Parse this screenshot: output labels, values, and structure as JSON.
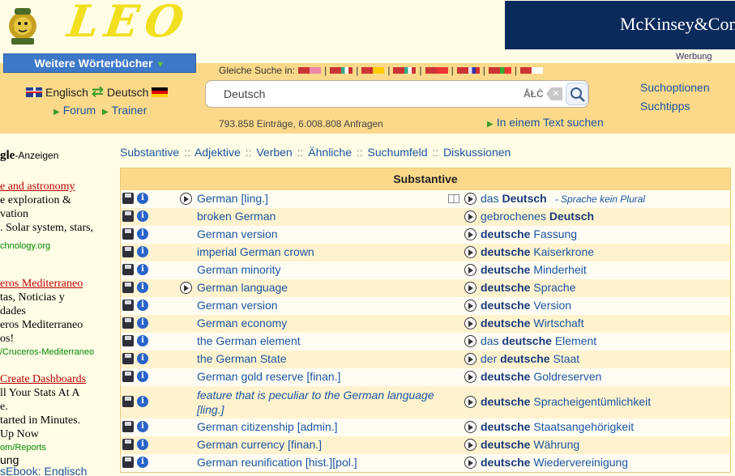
{
  "header": {
    "logo_text": "LEO",
    "ad_banner_text": "McKinsey&Company",
    "ad_label": "Werbung",
    "more_dicts_label": "Weitere Wörterbücher",
    "lang_from": "Englisch",
    "lang_to": "Deutsch",
    "forum_label": "Forum",
    "trainer_label": "Trainer",
    "same_search_label": "Gleiche Suche in:",
    "search_value": "Deutsch",
    "special_chars_label": "ÅŁĊ",
    "counts_text": "793.858 Einträge, 6.008.808 Anfragen",
    "text_search_label": "In einem Text suchen",
    "options": [
      "Suchoptionen",
      "Suchtipps"
    ]
  },
  "left_ads": {
    "google_label": "gle",
    "google_suffix": "-Anzeigen",
    "ads": [
      {
        "title": "e and astronomy",
        "lines": [
          "e exploration &",
          "vation",
          ". Solar system, stars,"
        ],
        "url": "chnology.org"
      },
      {
        "title": "eros Mediterraneo",
        "lines": [
          "tas, Noticias y",
          "dades",
          "eros Mediterraneo",
          "os!"
        ],
        "url": "/Cruceros-Mediterraneo"
      },
      {
        "title": "Create Dashboards",
        "lines": [
          "ll Your Stats At A",
          "e.",
          "tarted in Minutes.",
          "Up Now"
        ],
        "url": "om/Reports"
      }
    ],
    "tail": "ung",
    "ebook": "sEbook: Englisch"
  },
  "nav": {
    "items": [
      "Substantive",
      "Adjektive",
      "Verben",
      "Ähnliche",
      "Suchumfeld",
      "Diskussionen"
    ],
    "sep": "::"
  },
  "results": {
    "heading": "Substantive",
    "rows": [
      {
        "en": "German [ling.]",
        "de_pre": "das ",
        "de_bold": "Deutsch",
        "de_post": "",
        "gram": "- Sprache  kein Plural",
        "en_play": true,
        "book": true
      },
      {
        "en": "broken German",
        "de_pre": "gebrochenes ",
        "de_bold": "Deutsch",
        "de_post": ""
      },
      {
        "en": "German version",
        "de_pre": "",
        "de_bold": "deutsche",
        "de_post": " Fassung"
      },
      {
        "en": "imperial German crown",
        "de_pre": "",
        "de_bold": "deutsche",
        "de_post": " Kaiserkrone"
      },
      {
        "en": "German minority",
        "de_pre": "",
        "de_bold": "deutsche",
        "de_post": " Minderheit"
      },
      {
        "en": "German language",
        "de_pre": "",
        "de_bold": "deutsche",
        "de_post": " Sprache",
        "en_play": true
      },
      {
        "en": "German version",
        "de_pre": "",
        "de_bold": "deutsche",
        "de_post": " Version"
      },
      {
        "en": "German economy",
        "de_pre": "",
        "de_bold": "deutsche",
        "de_post": " Wirtschaft"
      },
      {
        "en": "the German element",
        "de_pre": "das ",
        "de_bold": "deutsche",
        "de_post": " Element"
      },
      {
        "en": "the German State",
        "de_pre": "der ",
        "de_bold": "deutsche",
        "de_post": " Staat"
      },
      {
        "en": "German gold reserve [finan.]",
        "de_pre": "",
        "de_bold": "deutsche",
        "de_post": " Goldreserven"
      },
      {
        "en": "feature that is peculiar to the German language [ling.]",
        "de_pre": "",
        "de_bold": "deutsche",
        "de_post": " Spracheigentümlichkeit",
        "tall": true
      },
      {
        "en": "German citizenship [admin.]",
        "de_pre": "",
        "de_bold": "deutsche",
        "de_post": " Staatsangehörigkeit"
      },
      {
        "en": "German currency [finan.]",
        "de_pre": "",
        "de_bold": "deutsche",
        "de_post": " Währung"
      },
      {
        "en": "German reunification [hist.][pol.]",
        "de_pre": "",
        "de_bold": "deutsche",
        "de_post": " Wiedervereinigung"
      }
    ]
  }
}
